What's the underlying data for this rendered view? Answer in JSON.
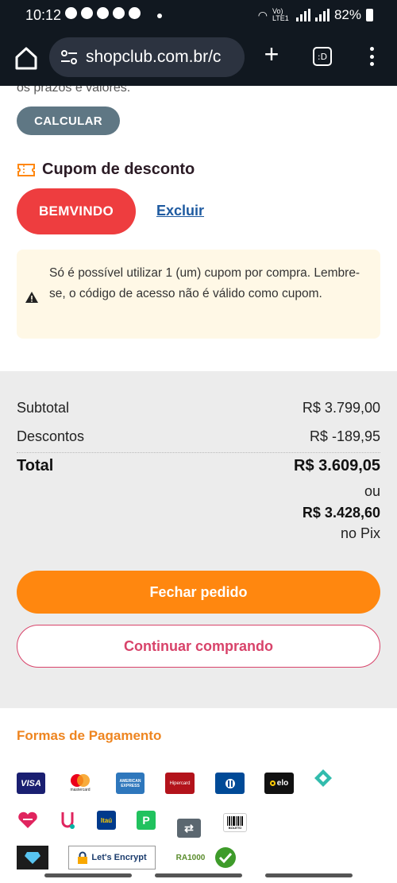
{
  "status_bar": {
    "time": "10:12",
    "network": "Vo) LTE1",
    "battery": "82%"
  },
  "browser": {
    "url": "shopclub.com.br/c",
    "tabs_label": ":D"
  },
  "shipping": {
    "cut_text": "os prazos e valores.",
    "calc_label": "CALCULAR"
  },
  "coupon": {
    "title": "Cupom de desconto",
    "code": "BEMVINDO",
    "remove_label": "Excluir",
    "notice": "Só é possível utilizar 1 (um) cupom por compra. Lembre-se, o código de acesso não é válido como cupom."
  },
  "summary": {
    "subtotal_label": "Subtotal",
    "subtotal_value": "R$ 3.799,00",
    "discount_label": "Descontos",
    "discount_value": "R$ -189,95",
    "total_label": "Total",
    "total_value": "R$ 3.609,05",
    "or_label": "ou",
    "pix_value": "R$ 3.428,60",
    "pix_label": "no Pix",
    "checkout_label": "Fechar pedido",
    "continue_label": "Continuar comprando"
  },
  "payments": {
    "title": "Formas de Pagamento",
    "visa": "VISA",
    "mastercard": "mastercard",
    "amex": "AMERICAN EXPRESS",
    "hipercard": "Hipercard",
    "elo": "elo",
    "itau": "Itaú",
    "boleto": "BOLETO",
    "lets_encrypt": "Let's Encrypt",
    "ra1000": "RA1000"
  },
  "colors": {
    "accent": "#ff870f",
    "coupon": "#ee3d3f",
    "outline": "#d8436a",
    "payments_title": "#ee8520"
  }
}
